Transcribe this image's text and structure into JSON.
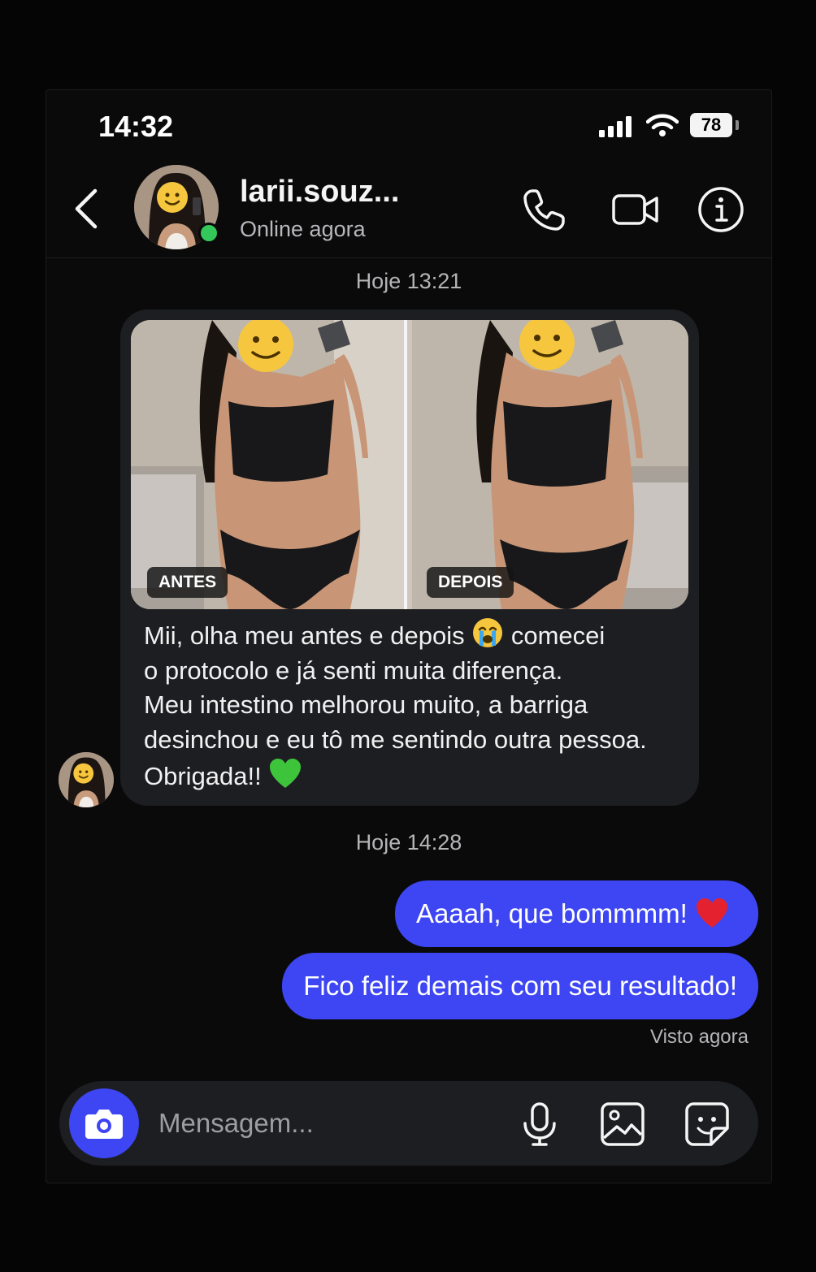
{
  "status_bar": {
    "time": "14:32",
    "battery": "78"
  },
  "header": {
    "username": "larii.souz...",
    "presence": "Online agora"
  },
  "thread": {
    "timestamp_1": "Hoje 13:21",
    "incoming_message": {
      "photo_labels": [
        "ANTES",
        "DEPOIS"
      ],
      "text_line_1": "Mii, olha meu antes e depois ",
      "text_line_1b": " comecei",
      "text_rest": "o protocolo e já senti muita diferença.\nMeu intestino melhorou muito, a barriga\ndesinchou e eu tô me sentindo outra pessoa.\nObrigada!! "
    },
    "timestamp_2": "Hoje 14:28",
    "outgoing_messages": [
      "Aaaah, que bommmm! ",
      "Fico feliz demais com seu resultado!"
    ],
    "read_receipt": "Visto agora"
  },
  "composer": {
    "placeholder": "Mensagem..."
  },
  "colors": {
    "background": "#050505",
    "incoming_bubble": "#1d1e22",
    "outgoing_bubble": "#3d46f2",
    "online": "#34c759"
  },
  "icons": [
    "back-arrow",
    "phone",
    "video-camera",
    "info",
    "camera",
    "microphone",
    "image",
    "sticker"
  ]
}
